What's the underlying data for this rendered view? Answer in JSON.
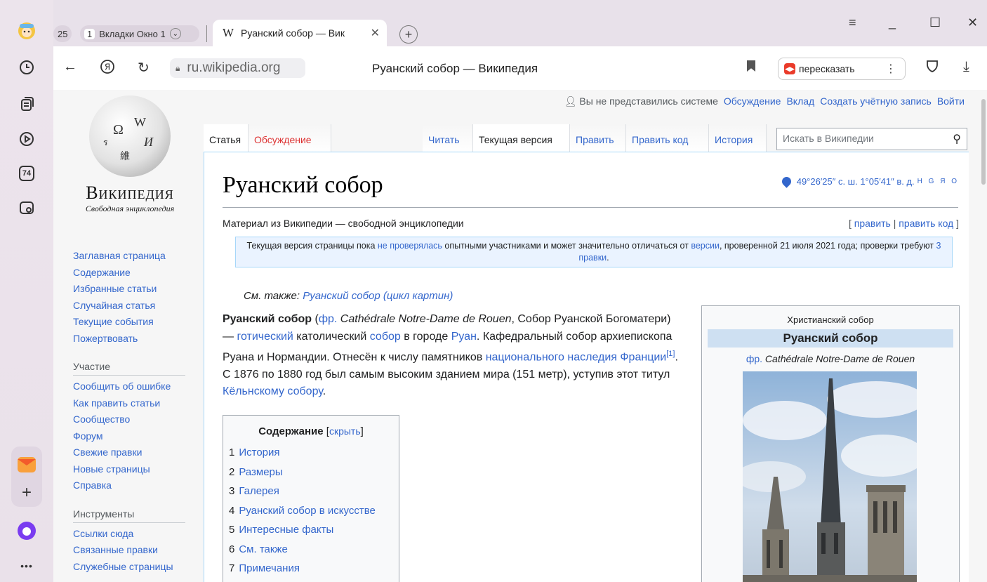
{
  "browser": {
    "tab_count": "25",
    "tab_group_count": "1",
    "tab_group_label": "Вкладки Окно 1",
    "active_tab_favicon": "W",
    "active_tab_title": "Руанский собор — Вик",
    "url": "ru.wikipedia.org",
    "page_title": "Руанский собор — Википедия",
    "retell_label": "пересказать",
    "rail_badge": "74"
  },
  "wiki": {
    "logo_name": "Википедия",
    "logo_tagline": "Свободная энциклопедия",
    "personal": {
      "anon": "Вы не представились системе",
      "talk": "Обсуждение",
      "contrib": "Вклад",
      "create": "Создать учётную запись",
      "login": "Войти"
    },
    "tabs": {
      "article": "Статья",
      "discussion": "Обсуждение",
      "read": "Читать",
      "current": "Текущая версия",
      "edit": "Править",
      "edit_source": "Править код",
      "history": "История"
    },
    "search_placeholder": "Искать в Википедии",
    "nav": {
      "main": [
        "Заглавная страница",
        "Содержание",
        "Избранные статьи",
        "Случайная статья",
        "Текущие события",
        "Пожертвовать"
      ],
      "participation_header": "Участие",
      "participation": [
        "Сообщить об ошибке",
        "Как править статьи",
        "Сообщество",
        "Форум",
        "Свежие правки",
        "Новые страницы",
        "Справка"
      ],
      "tools_header": "Инструменты",
      "tools": [
        "Ссылки сюда",
        "Связанные правки",
        "Служебные страницы"
      ]
    },
    "article": {
      "title": "Руанский собор",
      "coords": "49°26′25″ с. ш. 1°05′41″ в. д.",
      "coords_links": "H G Я O",
      "subtitle": "Материал из Википедии — свободной энциклопедии",
      "edit_open": "[ ",
      "edit": "править",
      "edit_sep": " | ",
      "edit_code": "править код",
      "edit_close": " ]",
      "notice_1": "Текущая версия страницы пока ",
      "notice_link1": "не проверялась",
      "notice_2": " опытными участниками и может значительно отличаться от ",
      "notice_link2": "версии",
      "notice_3": ", проверенной 21 июля 2021 года; проверки требуют ",
      "notice_link3": "3 правки",
      "notice_4": ".",
      "seealso_label": "См. также: ",
      "seealso_link": "Руанский собор (цикл картин)",
      "lead_bold": "Руанский собор",
      "lead_1": " (",
      "lead_fr": "фр.",
      "lead_2": " ",
      "lead_fr_name": "Cathédrale Notre-Dame de Rouen",
      "lead_3": ", Собор Руанской Богоматери) — ",
      "lead_l1": "готический",
      "lead_4": " католический ",
      "lead_l2": "собор",
      "lead_5": " в городе ",
      "lead_l3": "Руан",
      "lead_6": ". Кафедральный собор архиепископа Руана и Нормандии. Отнесён к числу памятников ",
      "lead_l4": "национального наследия Франции",
      "lead_ref": "[1]",
      "lead_7": ". С 1876 по 1880 год был самым высоким зданием мира (151 метр), уступив этот титул ",
      "lead_l5": "Кёльнскому собору",
      "lead_8": "."
    },
    "toc": {
      "title": "Содержание",
      "hide_open": " [",
      "hide": "скрыть",
      "hide_close": "]",
      "items": [
        {
          "num": "1",
          "label": "История"
        },
        {
          "num": "2",
          "label": "Размеры"
        },
        {
          "num": "3",
          "label": "Галерея"
        },
        {
          "num": "4",
          "label": "Руанский собор в искусстве"
        },
        {
          "num": "5",
          "label": "Интересные факты"
        },
        {
          "num": "6",
          "label": "См. также"
        },
        {
          "num": "7",
          "label": "Примечания"
        }
      ]
    },
    "infobox": {
      "above": "Христианский собор",
      "title": "Руанский собор",
      "lang": "фр.",
      "orig_name": "Cathédrale Notre-Dame de Rouen"
    }
  },
  "colors": {
    "link": "#3366cc",
    "redlink": "#dd3333",
    "browser_bg": "#e8e1ea"
  }
}
